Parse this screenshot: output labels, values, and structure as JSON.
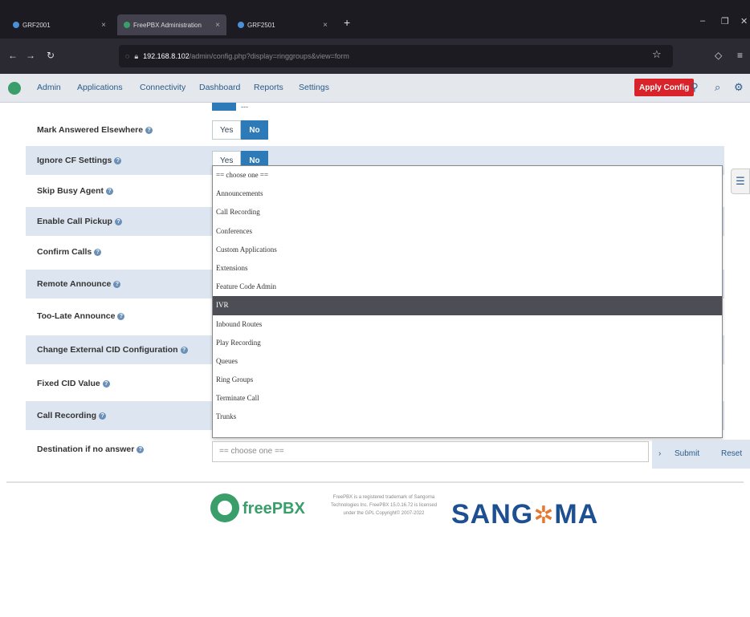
{
  "browser": {
    "tabs": [
      {
        "label": "GRF2001"
      },
      {
        "label": "FreePBX Administration"
      },
      {
        "label": "GRF2501"
      }
    ],
    "new_tab": "+",
    "url_host": "192.168.8.102",
    "url_path": "/admin/config.php?display=ringgroups&view=form",
    "window_controls": [
      "–",
      "❐",
      "✕"
    ]
  },
  "appbar": {
    "menu": [
      "Admin",
      "Applications",
      "Connectivity",
      "Dashboard",
      "Reports",
      "Settings"
    ],
    "apply_config": "Apply Config"
  },
  "form": {
    "rows": [
      {
        "label": "Mark Answered Elsewhere",
        "yes": "Yes",
        "no": "No",
        "selected": "No"
      },
      {
        "label": "Ignore CF Settings",
        "yes": "Yes",
        "no": "No",
        "selected": "No"
      },
      {
        "label": "Skip Busy Agent"
      },
      {
        "label": "Enable Call Pickup"
      },
      {
        "label": "Confirm Calls"
      },
      {
        "label": "Remote Announce"
      },
      {
        "label": "Too-Late Announce"
      },
      {
        "label": "Change External CID Configuration"
      },
      {
        "label": "Fixed CID Value"
      },
      {
        "label": "Call Recording"
      },
      {
        "label": "Destination if no answer"
      }
    ],
    "help_glyph": "?"
  },
  "dropdown": {
    "options": [
      "== choose one ==",
      "Announcements",
      "Call Recording",
      "Conferences",
      "Custom Applications",
      "Extensions",
      "Feature Code Admin",
      "IVR",
      "Inbound Routes",
      "Play Recording",
      "Queues",
      "Ring Groups",
      "Terminate Call",
      "Trunks"
    ],
    "selected": "IVR",
    "select_value": "== choose one =="
  },
  "footer": {
    "submit": "Submit",
    "reset": "Reset",
    "freepbx": "freePBX",
    "legal": "FreePBX is a registered trademark of Sangoma Technologies Inc. FreePBX 15.0.16.72 is licensed under the GPL Copyright© 2007-2022",
    "sangoma_left": "SANG",
    "sangoma_right": "MA"
  },
  "colors": {
    "accent": "#2c7ab8",
    "apply": "#d9232a",
    "freepbx_green": "#3a9e6a",
    "sangoma_blue": "#1d4f91"
  }
}
